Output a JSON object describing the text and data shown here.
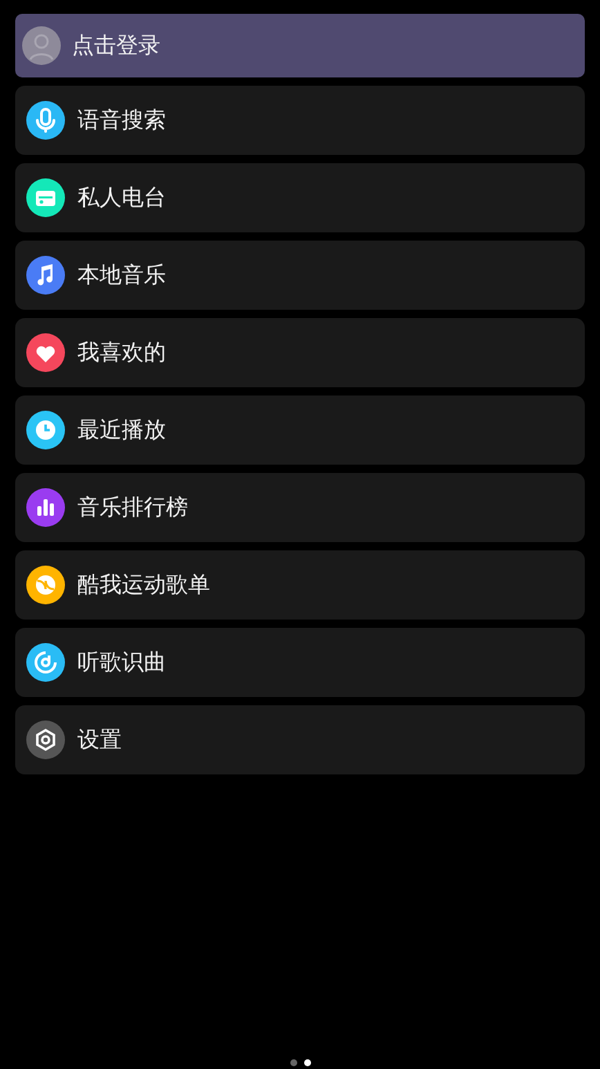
{
  "login": {
    "label": "点击登录"
  },
  "menu": [
    {
      "label": "语音搜索",
      "kind": "mic",
      "color": "#2ab8f5"
    },
    {
      "label": "私人电台",
      "kind": "radio",
      "color": "#14e8b8"
    },
    {
      "label": "本地音乐",
      "kind": "note",
      "color": "#4a7cf5"
    },
    {
      "label": "我喜欢的",
      "kind": "heart",
      "color": "#f5475c"
    },
    {
      "label": "最近播放",
      "kind": "clock",
      "color": "#2ac4f5"
    },
    {
      "label": "音乐排行榜",
      "kind": "bars",
      "color": "#9a3cf0"
    },
    {
      "label": "酷我运动歌单",
      "kind": "ball",
      "color": "#ffb400"
    },
    {
      "label": "听歌识曲",
      "kind": "recognize",
      "color": "#2abcf5"
    },
    {
      "label": "设置",
      "kind": "settings",
      "color": "#555555"
    }
  ],
  "pages": [
    {
      "selected": false
    },
    {
      "selected": true
    }
  ]
}
